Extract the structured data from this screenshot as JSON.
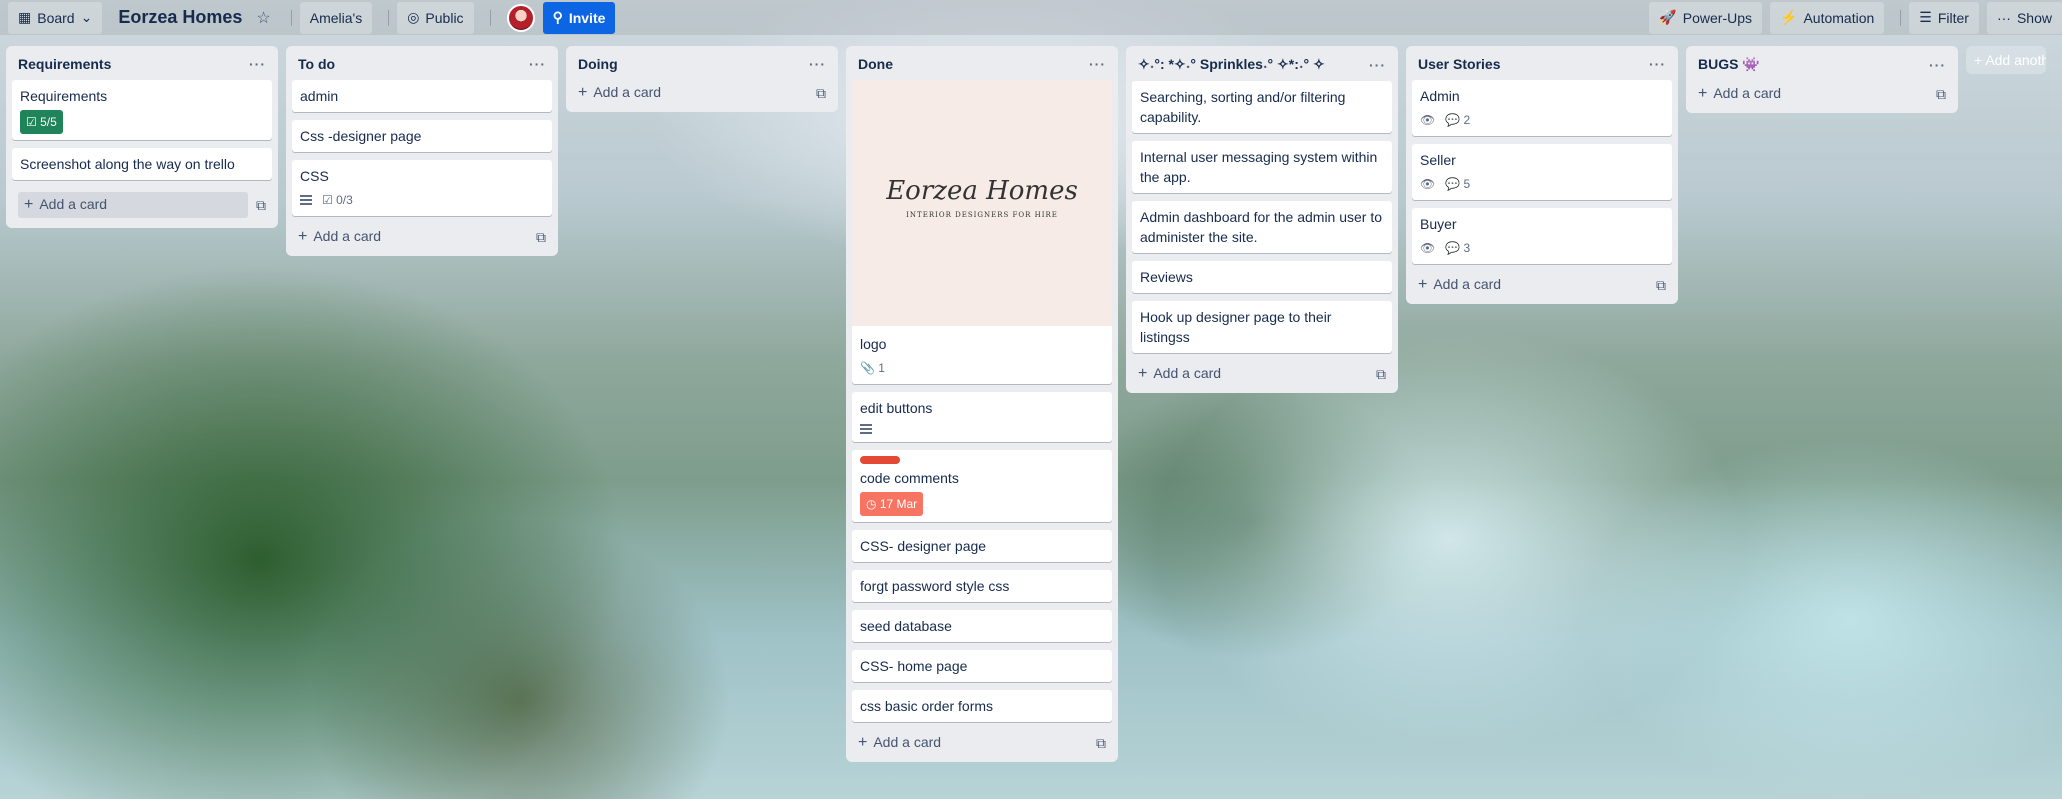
{
  "topbar": {
    "view_label": "Board",
    "board_title": "Eorzea Homes",
    "workspace": "Amelia's",
    "visibility": "Public",
    "invite": "Invite",
    "powerups": "Power-Ups",
    "automation": "Automation",
    "filter": "Filter",
    "show": "Show"
  },
  "lists": {
    "requirements": {
      "title": "Requirements",
      "cards": {
        "c0": {
          "title": "Requirements",
          "checklist": "5/5"
        },
        "c1": {
          "title": "Screenshot along the way on trello"
        }
      },
      "add": "Add a card"
    },
    "todo": {
      "title": "To do",
      "cards": {
        "c0": {
          "title": "admin"
        },
        "c1": {
          "title": "Css -designer page"
        },
        "c2": {
          "title": "CSS",
          "checklist": "0/3"
        }
      },
      "add": "Add a card"
    },
    "doing": {
      "title": "Doing",
      "add": "Add a card"
    },
    "done": {
      "title": "Done",
      "cover": {
        "logo": "Eorzea Homes",
        "tagline": "INTERIOR DESIGNERS FOR HIRE"
      },
      "cards": {
        "c0": {
          "title": "logo",
          "attachments": "1"
        },
        "c1": {
          "title": "edit buttons"
        },
        "c2": {
          "title": "code comments",
          "due": "17 Mar",
          "label_color": "#e34935"
        },
        "c3": {
          "title": "CSS- designer page"
        },
        "c4": {
          "title": "forgt password style css"
        },
        "c5": {
          "title": "seed database"
        },
        "c6": {
          "title": "CSS- home page"
        },
        "c7": {
          "title": "css basic order forms"
        }
      },
      "add": "Add a card"
    },
    "sprinkles": {
      "title": "✧˖°: *✧˖° Sprinkles˖° ✧*:˖° ✧",
      "cards": {
        "c0": {
          "title": "Searching, sorting and/or filtering capability."
        },
        "c1": {
          "title": "Internal user messaging system within the app."
        },
        "c2": {
          "title": "Admin dashboard for the admin user to administer the site."
        },
        "c3": {
          "title": "Reviews"
        },
        "c4": {
          "title": "Hook up designer page to their listingss"
        }
      },
      "add": "Add a card"
    },
    "stories": {
      "title": "User Stories",
      "cards": {
        "c0": {
          "title": "Admin",
          "comments": "2"
        },
        "c1": {
          "title": "Seller",
          "comments": "5"
        },
        "c2": {
          "title": "Buyer",
          "comments": "3"
        }
      },
      "add": "Add a card"
    },
    "bugs": {
      "title": "BUGS 👾",
      "add": "Add a card"
    }
  },
  "add_list": "Add anoth"
}
